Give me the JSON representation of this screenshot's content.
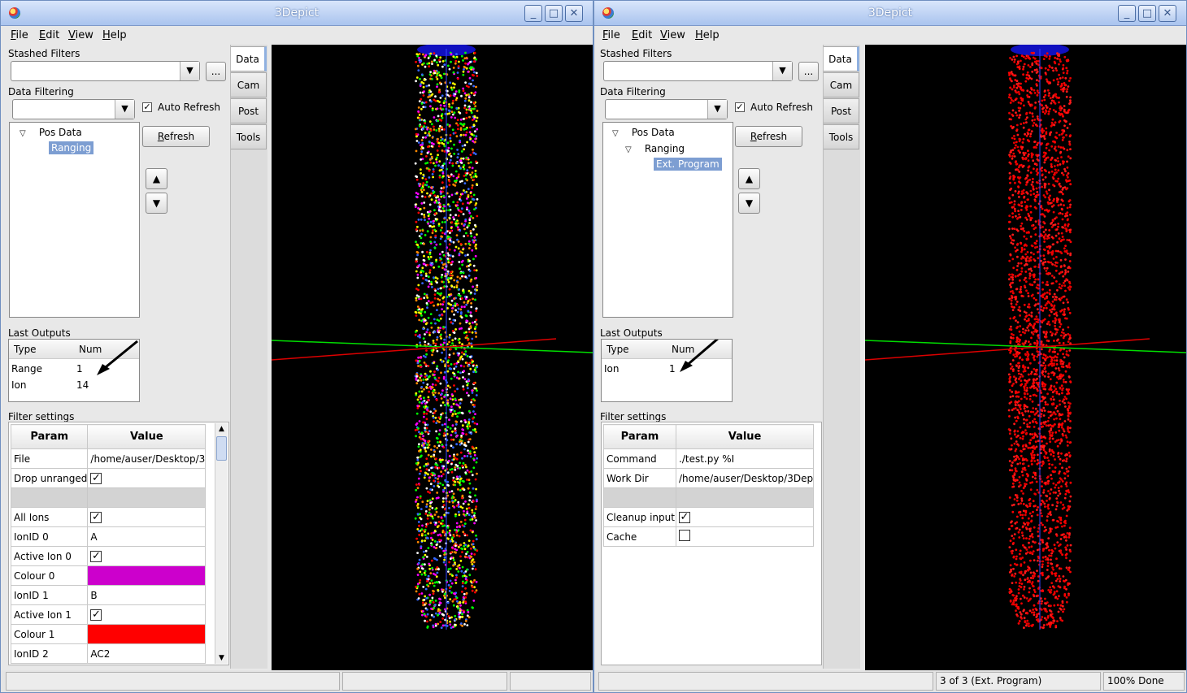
{
  "windows": [
    {
      "title": "3Depict",
      "menu": [
        "File",
        "Edit",
        "View",
        "Help"
      ],
      "stashed_label": "Stashed Filters",
      "stashed_value": "",
      "ellipsis_label": "...",
      "filtering_label": "Data Filtering",
      "filter_value": "",
      "auto_refresh_label": "Auto Refresh",
      "auto_refresh_checked": true,
      "refresh_label": "Refresh",
      "up_label": "▲",
      "down_label": "▼",
      "tree": [
        {
          "label": "Pos Data",
          "expanded": true,
          "selected": false
        },
        {
          "label": "Ranging",
          "expanded": false,
          "selected": true
        }
      ],
      "outputs_label": "Last Outputs",
      "outputs_headers": [
        "Type",
        "Num"
      ],
      "outputs_rows": [
        [
          "Range",
          "1"
        ],
        [
          "Ion",
          "14"
        ]
      ],
      "settings_label": "Filter settings",
      "settings_headers": [
        "Param",
        "Value"
      ],
      "settings_rows": [
        {
          "param": "File",
          "value": "/home/auser/Desktop/3",
          "kind": "text"
        },
        {
          "param": "Drop unranged",
          "value": true,
          "kind": "check"
        },
        {
          "param": "",
          "value": "",
          "kind": "sep"
        },
        {
          "param": "All Ions",
          "value": true,
          "kind": "check"
        },
        {
          "param": "IonID 0",
          "value": "A",
          "kind": "text"
        },
        {
          "param": "Active Ion 0",
          "value": true,
          "kind": "check"
        },
        {
          "param": "Colour 0",
          "value": "#cc00cc",
          "kind": "color"
        },
        {
          "param": "IonID 1",
          "value": "B",
          "kind": "text"
        },
        {
          "param": "Active Ion 1",
          "value": true,
          "kind": "check"
        },
        {
          "param": "Colour 1",
          "value": "#ff0000",
          "kind": "color"
        },
        {
          "param": "IonID 2",
          "value": "AC2",
          "kind": "text"
        }
      ],
      "tabs": [
        "Data",
        "Cam",
        "Post",
        "Tools"
      ],
      "active_tab": "Data",
      "point_colors": [
        "#ffff00",
        "#00ff00",
        "#ff0000",
        "#3366ff",
        "#ff00ff",
        "#ffffff",
        "#ff8800"
      ],
      "status": [
        "",
        "",
        ""
      ]
    },
    {
      "title": "3Depict",
      "menu": [
        "File",
        "Edit",
        "View",
        "Help"
      ],
      "stashed_label": "Stashed Filters",
      "stashed_value": "",
      "ellipsis_label": "...",
      "filtering_label": "Data Filtering",
      "filter_value": "",
      "auto_refresh_label": "Auto Refresh",
      "auto_refresh_checked": true,
      "refresh_label": "Refresh",
      "up_label": "▲",
      "down_label": "▼",
      "tree": [
        {
          "label": "Pos Data",
          "expanded": true,
          "selected": false
        },
        {
          "label": "Ranging",
          "expanded": true,
          "selected": false
        },
        {
          "label": "Ext. Program",
          "expanded": false,
          "selected": true
        }
      ],
      "outputs_label": "Last Outputs",
      "outputs_headers": [
        "Type",
        "Num"
      ],
      "outputs_rows": [
        [
          "Ion",
          "1"
        ]
      ],
      "settings_label": "Filter settings",
      "settings_headers": [
        "Param",
        "Value"
      ],
      "settings_rows": [
        {
          "param": "Command",
          "value": "./test.py %I",
          "kind": "text"
        },
        {
          "param": "Work Dir",
          "value": "/home/auser/Desktop/3Dep",
          "kind": "text"
        },
        {
          "param": "",
          "value": "",
          "kind": "sep"
        },
        {
          "param": "Cleanup input",
          "value": true,
          "kind": "check"
        },
        {
          "param": "Cache",
          "value": false,
          "kind": "check"
        }
      ],
      "tabs": [
        "Data",
        "Cam",
        "Post",
        "Tools"
      ],
      "active_tab": "Data",
      "point_colors": [
        "#ff0000",
        "#ff1a1a",
        "#e60000"
      ],
      "status": [
        "",
        "3 of 3 (Ext. Program)",
        "100% Done"
      ]
    }
  ]
}
